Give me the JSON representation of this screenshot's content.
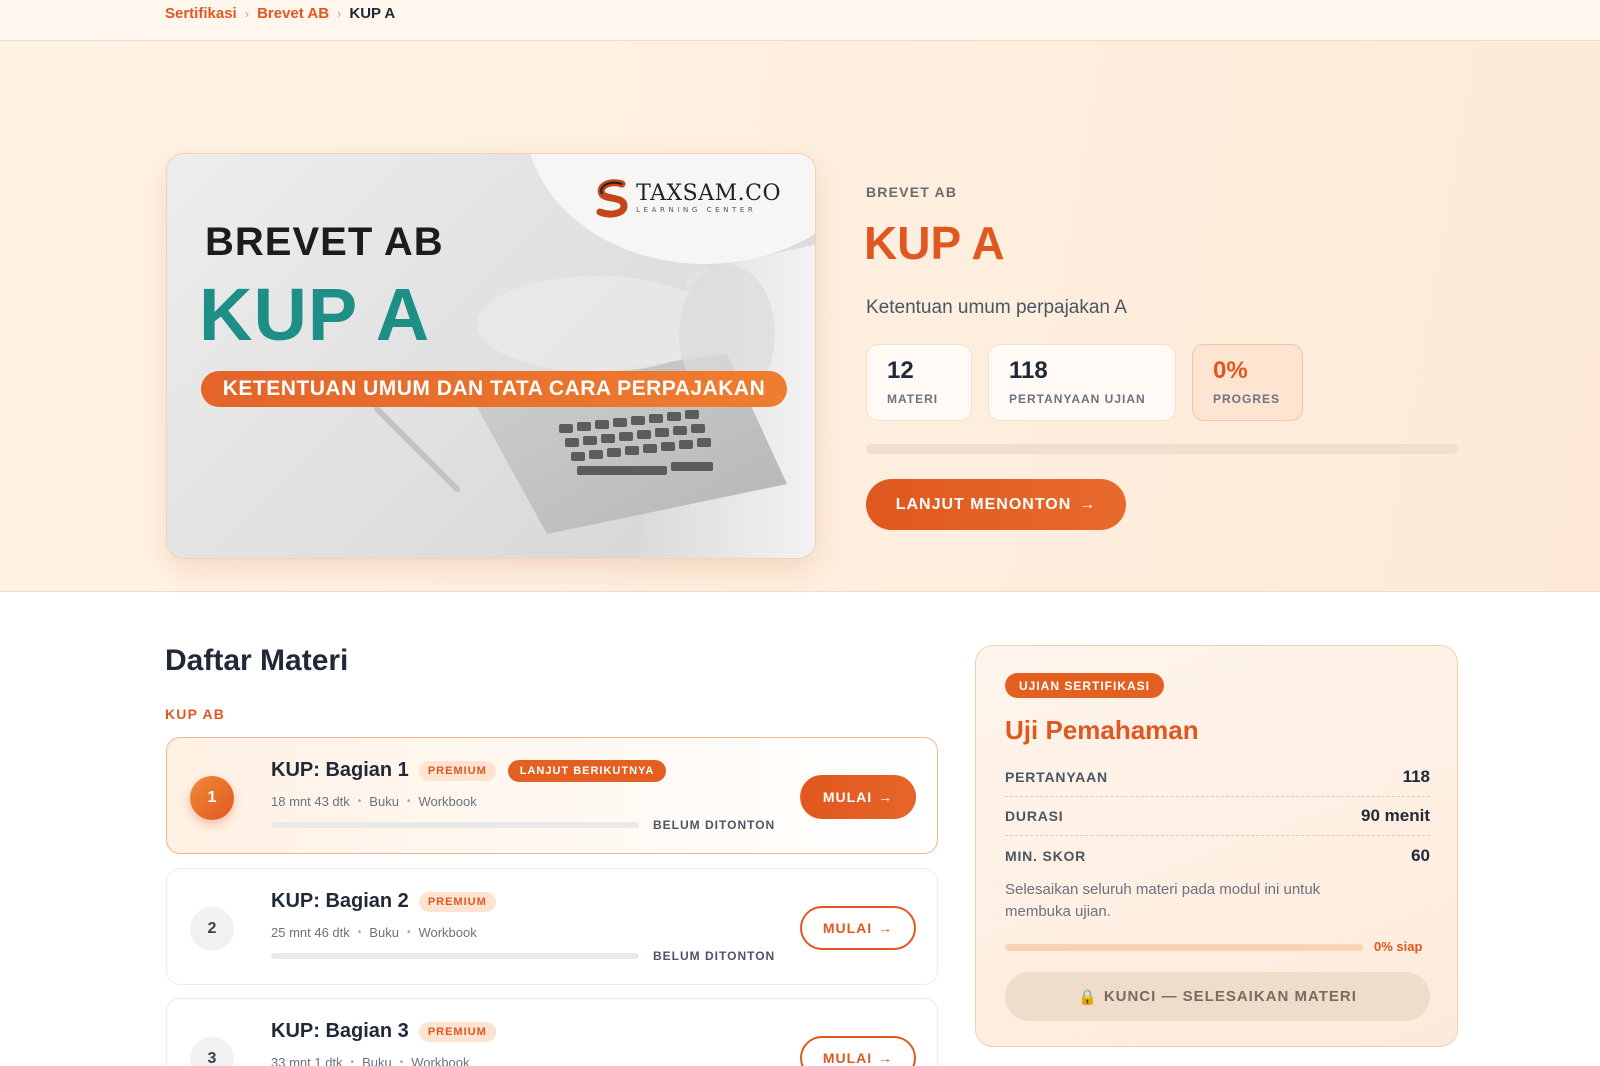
{
  "breadcrumb": {
    "items": [
      "Sertifikasi",
      "Brevet AB"
    ],
    "current": "KUP A",
    "separator": "›"
  },
  "hero": {
    "cover": {
      "logo_name": "TAXSAM.CO",
      "logo_sub": "LEARNING CENTER",
      "line1": "BREVET AB",
      "line2": "KUP A",
      "ribbon": "KETENTUAN UMUM DAN TATA CARA PERPAJAKAN"
    },
    "eyebrow": "BREVET AB",
    "title": "KUP A",
    "description": "Ketentuan umum perpajakan A",
    "stats": [
      {
        "value": "12",
        "label": "MATERI"
      },
      {
        "value": "118",
        "label": "PERTANYAAN UJIAN"
      },
      {
        "value": "0%",
        "label": "PROGRES"
      }
    ],
    "progress_fraction": 0,
    "continue_label": "LANJUT MENONTON",
    "continue_arrow": "→"
  },
  "materials": {
    "title": "Daftar Materi",
    "group_label": "KUP AB",
    "lessons": [
      {
        "number": "1",
        "title": "KUP: Bagian 1",
        "premium_badge": "PREMIUM",
        "next_badge": "LANJUT BERIKUTNYA",
        "duration": "18 mnt 43 dtk",
        "resource_1": "Buku",
        "resource_2": "Workbook",
        "status": "BELUM DITONTON",
        "progress_fraction": 0,
        "button_label": "MULAI",
        "button_arrow": "→"
      },
      {
        "number": "2",
        "title": "KUP: Bagian 2",
        "premium_badge": "PREMIUM",
        "duration": "25 mnt 46 dtk",
        "resource_1": "Buku",
        "resource_2": "Workbook",
        "status": "BELUM DITONTON",
        "progress_fraction": 0,
        "button_label": "MULAI",
        "button_arrow": "→"
      },
      {
        "number": "3",
        "title": "KUP: Bagian 3",
        "premium_badge": "PREMIUM",
        "duration": "33 mnt 1 dtk",
        "resource_1": "Buku",
        "resource_2": "Workbook",
        "button_label": "MULAI",
        "button_arrow": "→"
      }
    ]
  },
  "exam": {
    "badge": "UJIAN SERTIFIKASI",
    "title": "Uji Pemahaman",
    "rows": [
      {
        "key": "PERTANYAAN",
        "value": "118"
      },
      {
        "key": "DURASI",
        "value": "90 menit"
      },
      {
        "key": "MIN. SKOR",
        "value": "60"
      }
    ],
    "note": "Selesaikan seluruh materi pada modul ini untuk membuka ujian.",
    "progress_fraction": 0,
    "ready_label": "0% siap",
    "locked_icon": "🔒",
    "locked_label": "KUNCI — SELESAIKAN MATERI"
  },
  "colors": {
    "accent": "#e0581f",
    "teal": "#1d8f86",
    "hero_bg": "#fff3e6"
  },
  "icons": [
    "chevron-right-icon",
    "arrow-right-icon",
    "lock-icon",
    "taxsam-logo-icon"
  ]
}
